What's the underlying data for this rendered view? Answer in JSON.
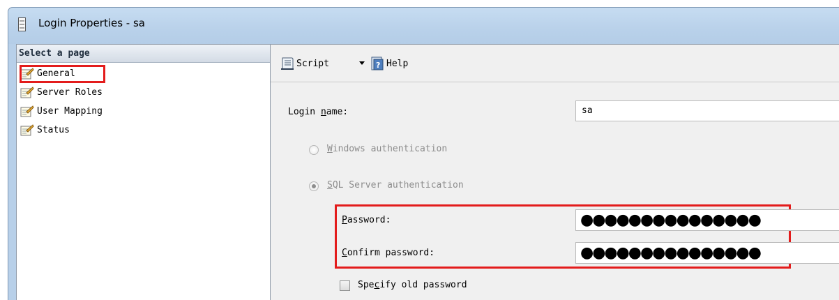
{
  "window": {
    "title": "Login Properties - sa"
  },
  "left_pane": {
    "header": "Select a page",
    "pages": [
      {
        "label": "General",
        "selected": true
      },
      {
        "label": "Server Roles",
        "selected": false
      },
      {
        "label": "User Mapping",
        "selected": false
      },
      {
        "label": "Status",
        "selected": false
      }
    ]
  },
  "toolbar": {
    "script_label": "Script",
    "help_label": "Help",
    "script_icon": "script-icon",
    "help_icon": "help-icon",
    "dropdown_icon": "dropdown-arrow-icon"
  },
  "form": {
    "login_name_label": "Login name:",
    "login_name_value": "sa",
    "windows_auth_label": "Windows authentication",
    "sql_auth_label": "SQL Server authentication",
    "sql_auth_selected": true,
    "password_label": "Password:",
    "password_value": "●●●●●●●●●●●●●●●",
    "confirm_password_label": "Confirm password:",
    "confirm_password_value": "●●●●●●●●●●●●●●●",
    "specify_old_password_label": "Specify old password",
    "specify_old_password_checked": false
  },
  "colors": {
    "highlight": "#e31c1c",
    "titlebar": "#b9d1ea",
    "pane_background": "#f0f0f0"
  }
}
